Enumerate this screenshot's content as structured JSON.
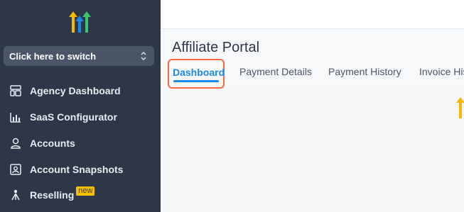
{
  "sidebar": {
    "switcher_label": "Click here to switch",
    "items": [
      {
        "label": "Agency Dashboard",
        "icon": "dashboard-icon"
      },
      {
        "label": "SaaS Configurator",
        "icon": "bar-chart-icon"
      },
      {
        "label": "Accounts",
        "icon": "user-icon"
      },
      {
        "label": "Account Snapshots",
        "icon": "account-snapshot-icon"
      },
      {
        "label": "Reselling",
        "icon": "reselling-icon",
        "badge": "new"
      }
    ]
  },
  "main": {
    "title": "Affiliate Portal",
    "tabs": [
      "Dashboard",
      "Payment Details",
      "Payment History",
      "Invoice His"
    ]
  },
  "colors": {
    "sidebar_bg": "#2d3748",
    "active_tab": "#1e88e5",
    "highlight_border": "#f46a3d",
    "badge_bg": "#f6c000"
  }
}
